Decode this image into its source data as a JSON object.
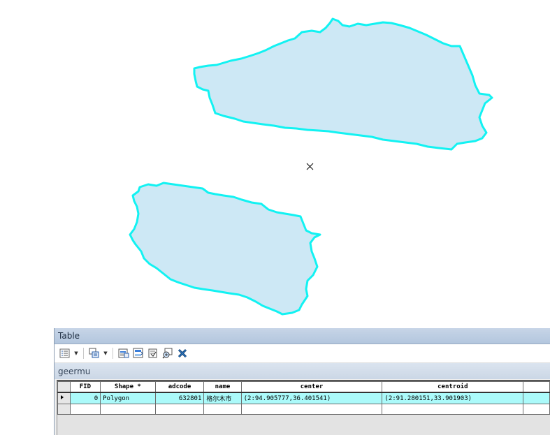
{
  "map": {
    "fill_color": "#cde8f5",
    "outline_color": "#12f2f2",
    "marker_icon": "x-marker-icon"
  },
  "table_window": {
    "title": "Table",
    "layer_tab": "geermu",
    "toolbar": {
      "options_icon": "table-options-icon",
      "related_icon": "related-tables-icon",
      "select_by_attr_icon": "select-by-attributes-icon",
      "switch_selection_icon": "switch-selection-icon",
      "clear_selection_icon": "clear-selection-icon",
      "zoom_selected_icon": "zoom-to-selected-icon",
      "delete_selected_icon": "delete-selected-icon"
    },
    "columns": [
      "FID",
      "Shape *",
      "adcode",
      "name",
      "center",
      "centroid"
    ],
    "rows": [
      {
        "FID": "0",
        "Shape": "Polygon",
        "adcode": "632801",
        "name": "格尔木市",
        "center": "(2:94.905777,36.401541)",
        "centroid": "(2:91.280151,33.901903)"
      }
    ],
    "selected_row_color": "#abfafa"
  }
}
